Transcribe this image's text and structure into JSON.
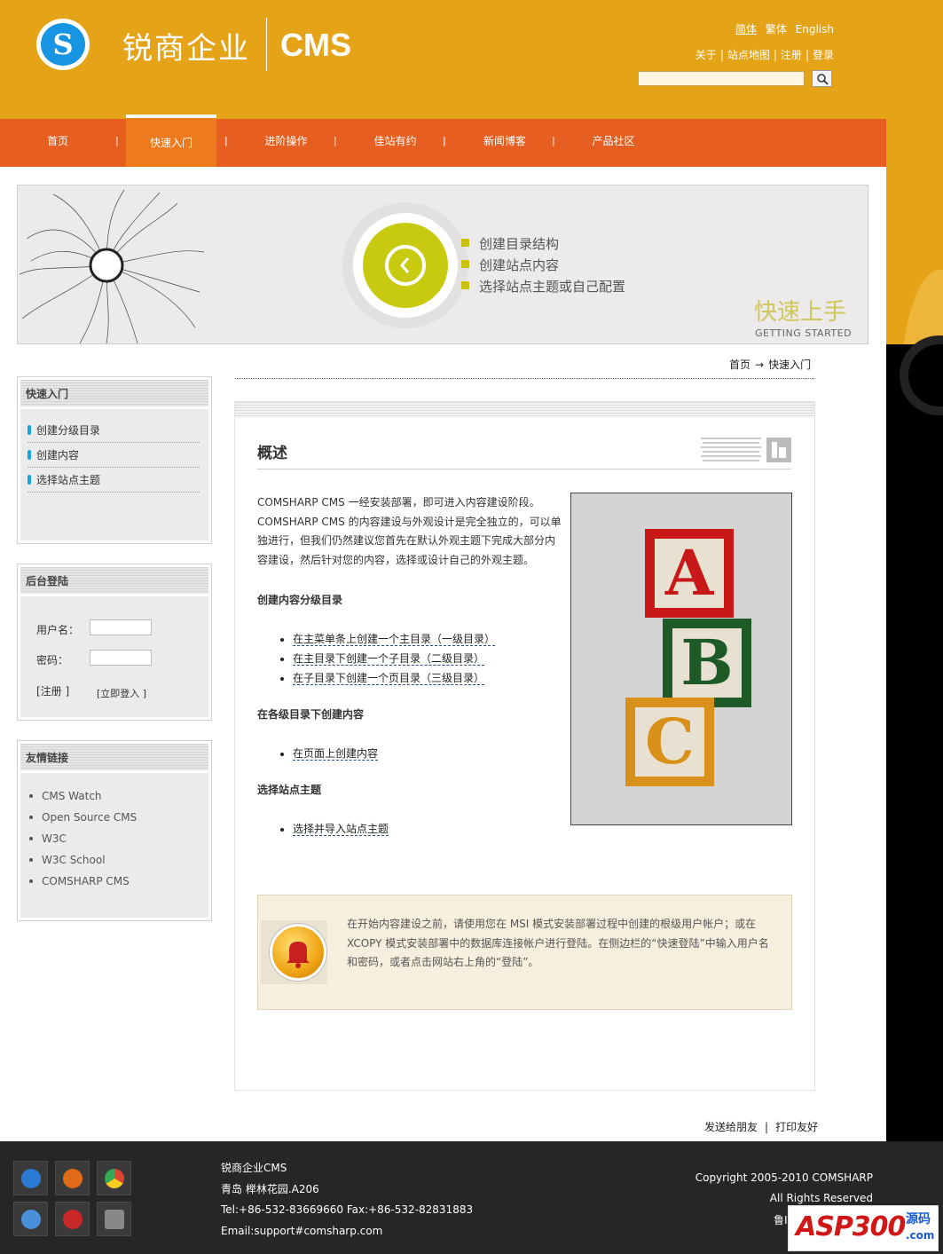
{
  "header": {
    "logo_letter": "S",
    "brand_name": "锐商企业",
    "brand_cms": "CMS",
    "lang": [
      "简体",
      "繁体",
      "English"
    ],
    "top_links": [
      "关于",
      "站点地图",
      "注册",
      "登录"
    ],
    "search_placeholder": ""
  },
  "nav": {
    "items": [
      "首页",
      "快速入门",
      "进阶操作",
      "佳站有约",
      "新闻博客",
      "产品社区"
    ],
    "active_index": 1,
    "separator": "|"
  },
  "banner": {
    "items": [
      "创建目录结构",
      "创建站点内容",
      "选择站点主题或自己配置"
    ],
    "title": "快速上手",
    "subtitle": "GETTING STARTED"
  },
  "breadcrumb": {
    "home": "首页",
    "arrow": "→",
    "current": "快速入门"
  },
  "sidebar": {
    "quick": {
      "title": "快速入门",
      "items": [
        "创建分级目录",
        "创建内容",
        "选择站点主题"
      ]
    },
    "login": {
      "title": "后台登陆",
      "username_label": "用户名：",
      "password_label": "密码：",
      "register": "[注册 ]",
      "login": "[立即登入 ]"
    },
    "links": {
      "title": "友情链接",
      "items": [
        "CMS Watch",
        "Open Source CMS",
        "W3C",
        "W3C School",
        "COMSHARP CMS"
      ]
    }
  },
  "content": {
    "title": "概述",
    "intro": "COMSHARP CMS 一经安装部署，即可进入内容建设阶段。COMSHARP CMS 的内容建设与外观设计是完全独立的，可以单独进行，但我们仍然建议您首先在默认外观主题下完成大部分内容建设，然后针对您的内容，选择或设计自己的外观主题。",
    "sections": [
      {
        "heading": "创建内容分级目录",
        "links": [
          "在主菜单条上创建一个主目录（一级目录）",
          "在主目录下创建一个子目录（二级目录）",
          "在子目录下创建一个页目录（三级目录）"
        ]
      },
      {
        "heading": "在各级目录下创建内容",
        "links": [
          "在页面上创建内容"
        ]
      },
      {
        "heading": "选择站点主题",
        "links": [
          "选择并导入站点主题"
        ]
      }
    ],
    "image_letters": [
      "A",
      "B",
      "C"
    ],
    "notice": "在开始内容建设之前，请使用您在 MSI 模式安装部署过程中创建的根级用户帐户；或在 XCOPY 模式安装部署中的数据库连接帐户进行登陆。在侧边栏的“快速登陆”中输入用户名和密码，或者点击网站右上角的“登陆”。"
  },
  "bottom_links": [
    "发送给朋友",
    "打印友好"
  ],
  "footer": {
    "lines": [
      "锐商企业CMS",
      "青岛 榉林花园.A206",
      "Tel:+86-532-83669660 Fax:+86-532-82831883",
      "Email:support#comsharp.com"
    ],
    "copyright": "Copyright 2005-2010 COMSHARP",
    "rights": "All Rights Reserved",
    "icp": "鲁I"
  },
  "watermark": {
    "asp": "ASP300",
    "yuan": "源码",
    "com": ".com"
  },
  "colors": {
    "header": "#e5a317",
    "nav": "#e75f20",
    "nav_active": "#ee7a1e",
    "accent_blue": "#1aa3d8",
    "banner_green": "#c8ca10"
  }
}
